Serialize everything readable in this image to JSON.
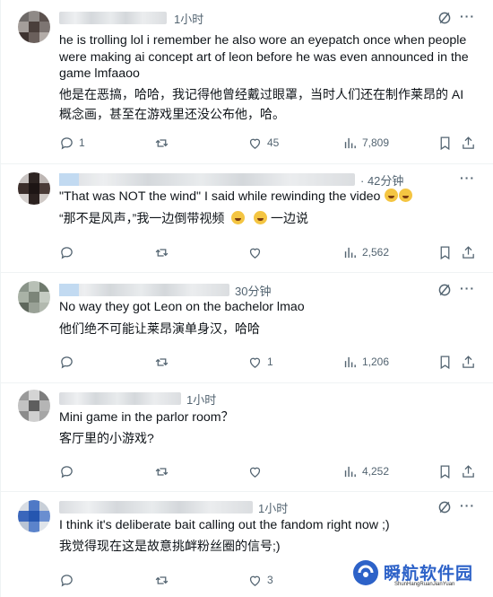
{
  "tweets": [
    {
      "time": "1小时",
      "text": "he is trolling lol i remember he also wore an eyepatch once when people were making ai concept art of leon before he was even announced in the game lmfaaoo",
      "translation": "他是在恶搞，哈哈，我记得他曾经戴过眼罩，当时人们还在制作莱昂的 AI 概念画，甚至在游戏里还没公布他，哈。",
      "replies": "1",
      "retweets": "",
      "likes": "45",
      "views": "7,809"
    },
    {
      "time": "· 42分钟",
      "text": "\"That was NOT the wind\" I said while rewinding the video",
      "translation_a": "“那不是风声，”我一边倒带视频",
      "translation_b": "一边说",
      "replies": "",
      "retweets": "",
      "likes": "",
      "views": "2,562"
    },
    {
      "time": "30分钟",
      "text": "No way they got Leon on the bachelor lmao",
      "translation": "他们绝不可能让莱昂演单身汉，哈哈",
      "replies": "",
      "retweets": "",
      "likes": "1",
      "views": "1,206"
    },
    {
      "time": "1小时",
      "text": "Mini game in the parlor room？",
      "translation": "客厅里的小游戏?",
      "replies": "",
      "retweets": "",
      "likes": "",
      "views": "4,252"
    },
    {
      "time": "1小时",
      "text": "I think it's deliberate bait calling out the fandom right now ;)",
      "translation": "我觉得现在这是故意挑衅粉丝圈的信号;)",
      "replies": "",
      "retweets": "",
      "likes": "3",
      "views": ""
    }
  ],
  "watermark": {
    "title": "瞬航软件园",
    "subtitle": "ShunHangRuanJianYuan"
  },
  "icons": [
    "grok-icon",
    "more-icon",
    "reply-icon",
    "retweet-icon",
    "like-icon",
    "views-icon",
    "bookmark-icon",
    "share-icon"
  ],
  "colors": {
    "text": "#0f1419",
    "muted": "#536471",
    "divider": "#eff3f4",
    "watermark": "#2d62c8"
  }
}
